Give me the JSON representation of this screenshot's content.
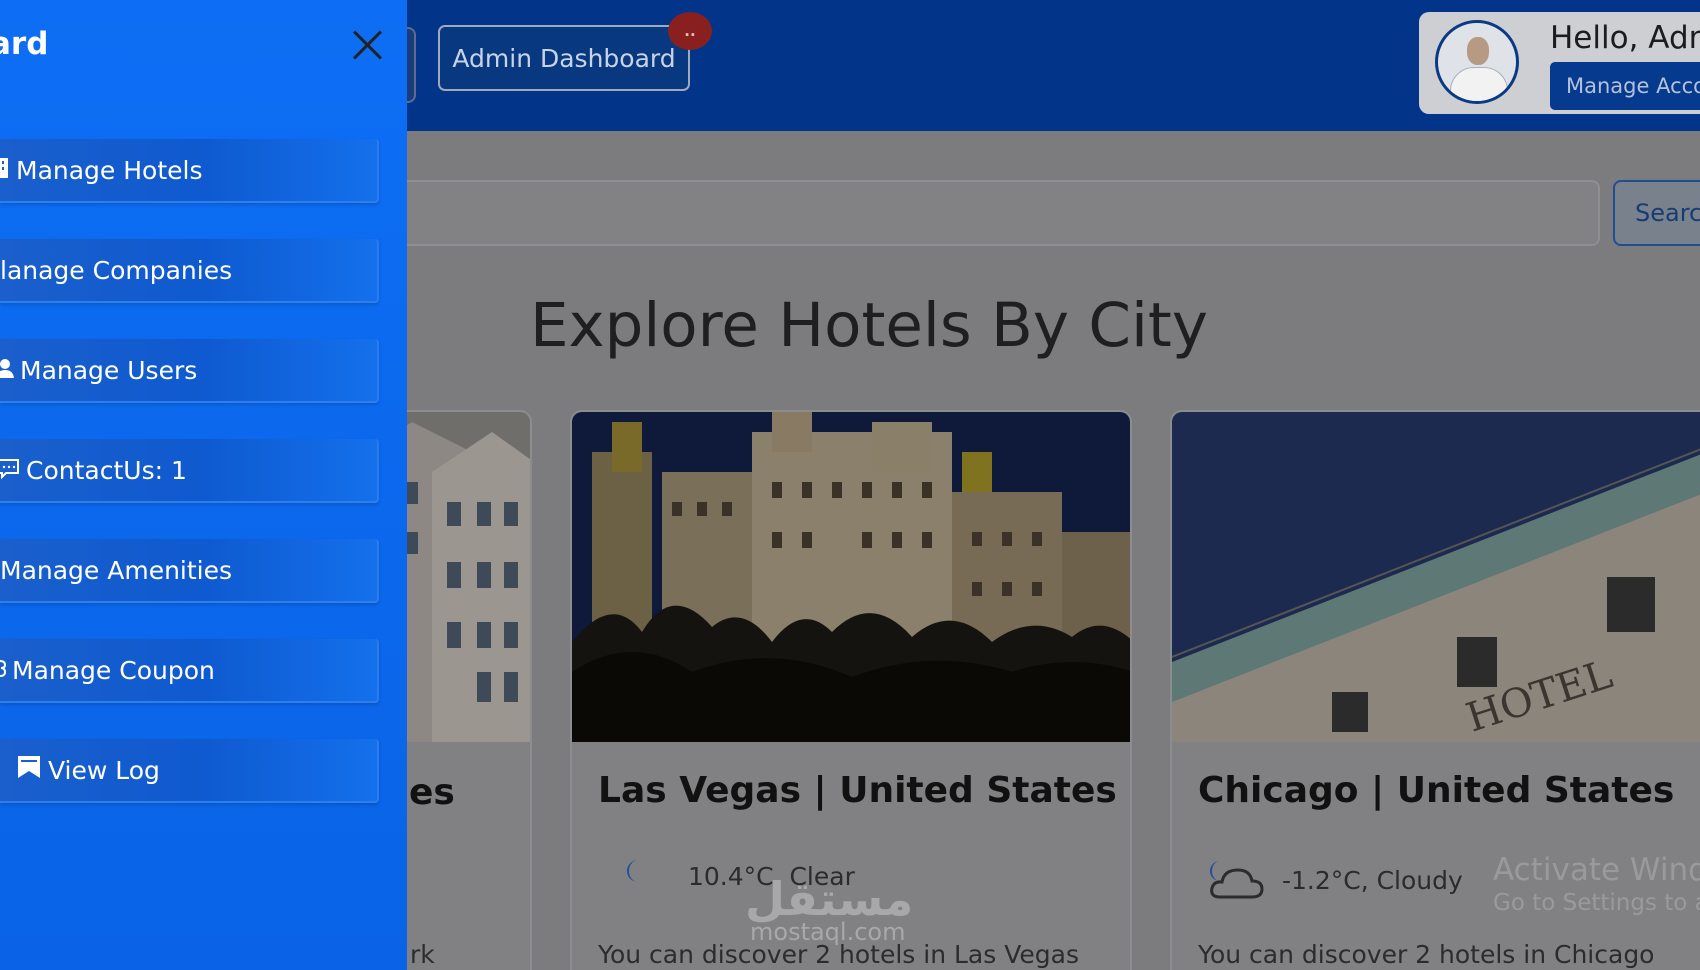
{
  "sidebar": {
    "title": "ard",
    "items": [
      {
        "label": "Manage Hotels",
        "icon": "building-icon"
      },
      {
        "label": "lanage Companies",
        "icon": ""
      },
      {
        "label": "Manage Users",
        "icon": "user-icon"
      },
      {
        "label": "ContactUs:  1",
        "icon": "chat-icon"
      },
      {
        "label": "Manage Amenities",
        "icon": ""
      },
      {
        "label": "Manage Coupon",
        "icon": "tag-icon"
      },
      {
        "label": "View Log",
        "icon": "bookmark-icon"
      }
    ]
  },
  "header": {
    "admin_button": "Admin Dashboard",
    "notification_badge": "..",
    "greeting": "Hello, Adm",
    "manage_account": "Manage Acco"
  },
  "search": {
    "button_label": "Searc"
  },
  "main": {
    "section_title": "Explore Hotels By City",
    "cards": [
      {
        "title_tail": "es",
        "text_tail": "rk"
      },
      {
        "title": "Las Vegas | United States",
        "weather": "10.4°C, Clear",
        "weather_icon": "moon-icon",
        "discover": "You can discover 2 hotels in Las Vegas"
      },
      {
        "title": "Chicago | United States",
        "weather": "-1.2°C, Cloudy",
        "weather_icon": "cloud-moon-icon",
        "discover": "You can discover 2 hotels in Chicago"
      }
    ]
  },
  "watermark": {
    "activate": "Activate Windo",
    "settings": "Go to Settings to ac",
    "logo": "مستقل",
    "logo_sub": "mostaql.com"
  },
  "colors": {
    "sidebar": "#0d6ef5",
    "topbar": "#02348a",
    "overlay_gray": "#7c7c7e",
    "badge": "#8a1f1f"
  }
}
